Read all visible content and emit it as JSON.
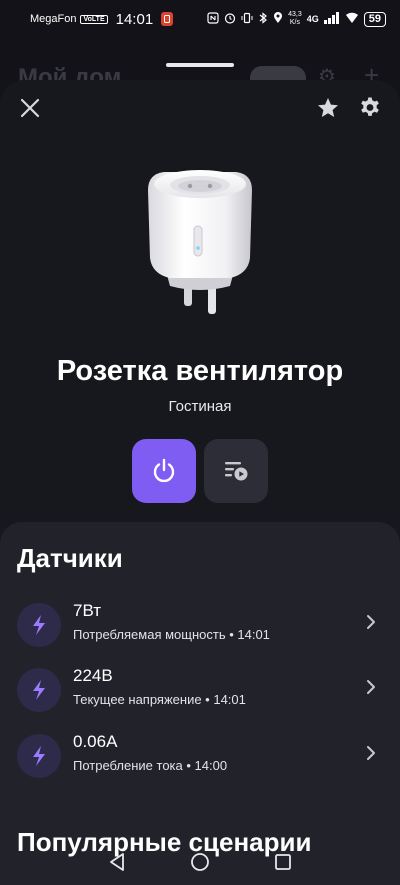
{
  "status_bar": {
    "carrier": "MegaFon",
    "volte": "VoLTE",
    "time": "14:01",
    "network_speed_value": "43,3",
    "network_speed_unit": "K/s",
    "signal_type": "4G",
    "battery": "59"
  },
  "background_page": {
    "title": "Мой дом"
  },
  "device": {
    "name": "Розетка вентилятор",
    "room": "Гостиная"
  },
  "sensors": {
    "title": "Датчики",
    "items": [
      {
        "value": "7Вт",
        "label": "Потребляемая мощность • 14:01"
      },
      {
        "value": "224В",
        "label": "Текущее напряжение • 14:01"
      },
      {
        "value": "0.06А",
        "label": "Потребление тока • 14:00"
      }
    ]
  },
  "popular": {
    "title": "Популярные сценарии"
  },
  "colors": {
    "accent": "#7f5cf2",
    "background": "#121218",
    "sheet": "#17171e",
    "panel": "#22222b"
  },
  "icons": {
    "close": "close-icon",
    "favorite": "star-icon",
    "settings": "gear-icon",
    "power": "power-icon",
    "scenario": "scenario-icon",
    "sensor": "lightning-icon",
    "chevron": "chevron-right-icon"
  }
}
